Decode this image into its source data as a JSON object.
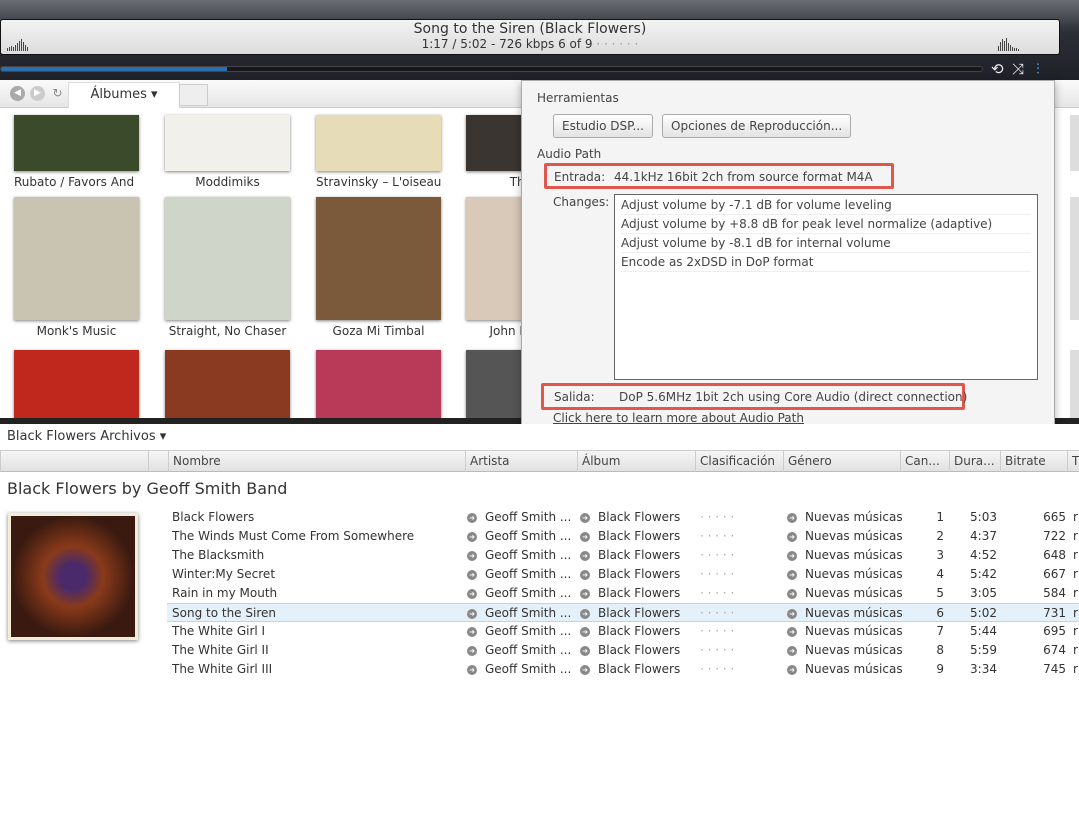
{
  "player": {
    "title": "Song to the Siren (Black Flowers)",
    "status": "1:17 / 5:02 - 726 kbps   6 of 9",
    "rating": "· · · · · ·",
    "progress_percent": 23
  },
  "controls": {
    "repeat": "⟲",
    "shuffle": "⤨",
    "eq": "⫶"
  },
  "nav": {
    "albums_tab": "Álbumes ▾"
  },
  "albums": [
    {
      "label": "Rubato / Favors And Fi...",
      "color": "#3a4a2a"
    },
    {
      "label": "Moddimiks",
      "color": "#f2f0ea"
    },
    {
      "label": "Stravinsky – L'oiseau d...",
      "color": "#e6dcb8"
    },
    {
      "label": "The ...",
      "color": "#3a3530"
    },
    {
      "label": "Monk's Music",
      "color": "#c9c3b2"
    },
    {
      "label": "Straight, No Chaser",
      "color": "#cfd5c8"
    },
    {
      "label": "Goza Mi Timbal",
      "color": "#7a5a3a"
    },
    {
      "label": "John Barley...",
      "color": "#d8c9b8"
    },
    {
      "label": "",
      "color": "#c0281e"
    },
    {
      "label": "",
      "color": "#8a3a20"
    },
    {
      "label": "",
      "color": "#b93a58"
    },
    {
      "label": "",
      "color": "#555"
    }
  ],
  "popup": {
    "tools_heading": "Herramientas",
    "dsp_button": "Estudio DSP...",
    "playback_button": "Opciones de Reproducción...",
    "audio_path_heading": "Audio Path",
    "input_label": "Entrada:",
    "input_value": "44.1kHz 16bit 2ch from source format M4A",
    "changes_label": "Changes:",
    "changes": [
      "Adjust volume by -7.1 dB for volume leveling",
      "Adjust volume by +8.8 dB for peak level normalize (adaptive)",
      "Adjust volume by -8.1 dB for internal volume",
      "Encode as 2xDSD in DoP format"
    ],
    "output_label": "Salida:",
    "output_value": "DoP 5.6MHz 1bit 2ch using Core Audio (direct connection)",
    "learn_more": "Click here to learn more about Audio Path",
    "highlight_color": "#e0584d"
  },
  "files": {
    "title": "Black Flowers Archivos ▾",
    "group": "Black Flowers by Geoff Smith Band",
    "columns": [
      "Nombre",
      "Artista",
      "Álbum",
      "Clasificación",
      "Género",
      "Can...",
      "Dura...",
      "Bitrate",
      "T"
    ],
    "rows": [
      {
        "name": "Black Flowers",
        "artist": "Geoff Smith ...",
        "album": "Black Flowers",
        "rating": "· · · · ·",
        "genre": "Nuevas músicas",
        "track": "1",
        "duration": "5:03",
        "bitrate": "665",
        "t": "r"
      },
      {
        "name": "The Winds Must Come From Somewhere",
        "artist": "Geoff Smith ...",
        "album": "Black Flowers",
        "rating": "· · · · ·",
        "genre": "Nuevas músicas",
        "track": "2",
        "duration": "4:37",
        "bitrate": "722",
        "t": "r"
      },
      {
        "name": "The Blacksmith",
        "artist": "Geoff Smith ...",
        "album": "Black Flowers",
        "rating": "· · · · ·",
        "genre": "Nuevas músicas",
        "track": "3",
        "duration": "4:52",
        "bitrate": "648",
        "t": "r"
      },
      {
        "name": "Winter:My Secret",
        "artist": "Geoff Smith ...",
        "album": "Black Flowers",
        "rating": "· · · · ·",
        "genre": "Nuevas músicas",
        "track": "4",
        "duration": "5:42",
        "bitrate": "667",
        "t": "r"
      },
      {
        "name": "Rain in my Mouth",
        "artist": "Geoff Smith ...",
        "album": "Black Flowers",
        "rating": "· · · · ·",
        "genre": "Nuevas músicas",
        "track": "5",
        "duration": "3:05",
        "bitrate": "584",
        "t": "r"
      },
      {
        "name": "Song to the Siren",
        "artist": "Geoff Smith ...",
        "album": "Black Flowers",
        "rating": "· · · · ·",
        "genre": "Nuevas músicas",
        "track": "6",
        "duration": "5:02",
        "bitrate": "731",
        "t": "r",
        "selected": true
      },
      {
        "name": "The White Girl I",
        "artist": "Geoff Smith ...",
        "album": "Black Flowers",
        "rating": "· · · · ·",
        "genre": "Nuevas músicas",
        "track": "7",
        "duration": "5:44",
        "bitrate": "695",
        "t": "r"
      },
      {
        "name": "The White Girl II",
        "artist": "Geoff Smith ...",
        "album": "Black Flowers",
        "rating": "· · · · ·",
        "genre": "Nuevas músicas",
        "track": "8",
        "duration": "5:59",
        "bitrate": "674",
        "t": "r"
      },
      {
        "name": "The White Girl III",
        "artist": "Geoff Smith ...",
        "album": "Black Flowers",
        "rating": "· · · · ·",
        "genre": "Nuevas músicas",
        "track": "9",
        "duration": "3:34",
        "bitrate": "745",
        "t": "r"
      }
    ]
  }
}
